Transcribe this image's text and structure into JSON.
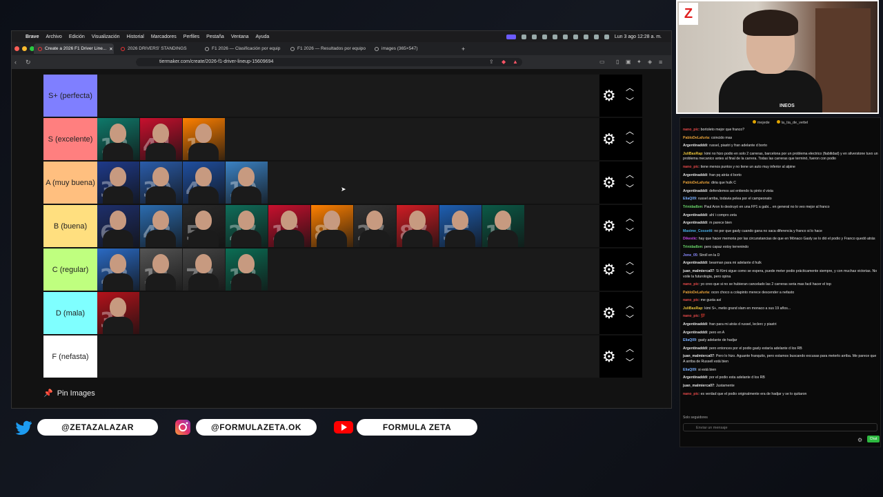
{
  "mac_menu": {
    "items": [
      "Brave",
      "Archivo",
      "Edición",
      "Visualización",
      "Historial",
      "Marcadores",
      "Perfiles",
      "Pestaña",
      "Ventana",
      "Ayuda"
    ],
    "clock": "Lun 3 ago 12:28 a. m."
  },
  "browser": {
    "tabs": [
      {
        "title": "Create a 2026 F1 Driver Line..."
      },
      {
        "title": "2026 DRIVERS' STANDINGS"
      },
      {
        "title": "F1 2026 — Clasificación por equip"
      },
      {
        "title": "F1 2026 — Resultados por equipo"
      },
      {
        "title": "images (365×547)"
      }
    ],
    "url": "tiermaker.com/create/2026-f1-driver-lineup-15609694"
  },
  "tiers": [
    {
      "label": "S+ (perfecta)",
      "color": "#7f7fff",
      "drivers": []
    },
    {
      "label": "S (excelente)",
      "color": "#ff7f7f",
      "drivers": [
        {
          "num": "12",
          "team": "#0f7a6b"
        },
        {
          "num": "44",
          "team": "#c8102e"
        },
        {
          "num": "1",
          "team": "#ff8000"
        }
      ]
    },
    {
      "label": "A (muy buena)",
      "color": "#ffbf7f",
      "drivers": [
        {
          "num": "3",
          "team": "#1e3a8a"
        },
        {
          "num": "30",
          "team": "#2a5caa"
        },
        {
          "num": "41",
          "team": "#1f4fa0"
        },
        {
          "num": "10",
          "team": "#3b82c4"
        }
      ]
    },
    {
      "label": "B (buena)",
      "color": "#ffdf7f",
      "drivers": [
        {
          "num": "6",
          "team": "#1e2f6b"
        },
        {
          "num": "43",
          "team": "#2b6cb0"
        },
        {
          "num": "5",
          "team": "#2a2a2a"
        },
        {
          "num": "27",
          "team": "#0f6e5a"
        },
        {
          "num": "16",
          "team": "#c8102e"
        },
        {
          "num": "81",
          "team": "#ff8000"
        },
        {
          "num": "27",
          "team": "#333333"
        },
        {
          "num": "87",
          "team": "#d01c24"
        },
        {
          "num": "55",
          "team": "#1e5fb3"
        },
        {
          "num": "14",
          "team": "#0b5a47"
        }
      ]
    },
    {
      "label": "C (regular)",
      "color": "#bfff7f",
      "drivers": [
        {
          "num": "23",
          "team": "#2a6ac4"
        },
        {
          "num": "11",
          "team": "#555555"
        },
        {
          "num": "77",
          "team": "#444444"
        },
        {
          "num": "18",
          "team": "#0b6e55"
        }
      ]
    },
    {
      "label": "D (mala)",
      "color": "#7fffff",
      "drivers": [
        {
          "num": "31",
          "team": "#b5121b"
        }
      ]
    },
    {
      "label": "F (nefasta)",
      "color": "#ffffff",
      "drivers": []
    }
  ],
  "pin_label": "Pin Images",
  "webcam": {
    "logo": "Z",
    "brand": "INEOS"
  },
  "chat": {
    "header": [
      {
        "name": "mejede"
      },
      {
        "name": "la_tia_de_vettel"
      }
    ],
    "messages": [
      {
        "user": "nano_pic",
        "color": "#e84a4a",
        "text": "bortoleto mejor que franco?"
      },
      {
        "user": "PabloDeLafuria",
        "color": "#e8a23a",
        "text": "coincido mas"
      },
      {
        "user": "Argentinadddi",
        "color": "#e4e4e4",
        "text": "russel, piastri y fran adelante d borto"
      },
      {
        "user": "JuliBasRap",
        "color": "#e8c23a",
        "text": "kimi no hizo podio en solo 2 carreras, barcelona por un problema electrico (fiabilidad) y en silverstone tuvo un problema mecanico antes al final de la carrera. Todas las carreras que terminó, fueron con podio"
      },
      {
        "user": "nano_pic",
        "color": "#e84a4a",
        "text": "tiene menos puntos y no tiene un auto muy inferior al alpine"
      },
      {
        "user": "Argentinadddi",
        "color": "#e4e4e4",
        "text": "fran pq atrás d borto"
      },
      {
        "user": "PabloDeLafuria",
        "color": "#e8a23a",
        "text": "diria que hulk C"
      },
      {
        "user": "Argentinadddi",
        "color": "#e4e4e4",
        "text": "defendemos asi entiendo tu pinto d vista"
      },
      {
        "user": "EliaQ09",
        "color": "#7ab0ff",
        "text": "russel arriba, todavia pelea por el campeonato"
      },
      {
        "user": "Trinidadbm",
        "color": "#6ad46a",
        "text": "Paul Aron lo destruyó en una FP1 a gabi... en general no lo veo mejor al franco"
      },
      {
        "user": "Argentinadddi",
        "color": "#e4e4e4",
        "text": "ahí i compro zeta"
      },
      {
        "user": "Argentinadddi",
        "color": "#e4e4e4",
        "text": "m parece bien"
      },
      {
        "user": "Maxime_Cossetti",
        "color": "#4ab0e8",
        "text": "no por que gasly cuando gana no saca diferencia y franco si lo hace"
      },
      {
        "user": "Dikestic",
        "color": "#c84ae8",
        "text": "hay que hacer memoria por las circunstancias de que en Mónaco Gasly se lo dió el podio y Franco quedó atrás"
      },
      {
        "user": "Trinidadbm",
        "color": "#6ad46a",
        "text": "pero capaz estoy terrenindo"
      },
      {
        "user": "Jone_05",
        "color": "#8a8aff",
        "text": "Stroll en la D"
      },
      {
        "user": "Argentinadddi",
        "color": "#e4e4e4",
        "text": "bearman para mi adelante d hulk"
      },
      {
        "user": "juan_malmierca07",
        "color": "#e4e4e4",
        "text": "Si Kimi sigue como se espera, puede meter podio prácticamente siempre, y con muchas victorias. No voile la futurologia, pero opina"
      },
      {
        "user": "nano_pic",
        "color": "#e84a4a",
        "text": "yo creo que si no se hubieran cancelado las 2 carreras seria mas facil hacer el top"
      },
      {
        "user": "PabloDeLafuria",
        "color": "#e8a23a",
        "text": "ocon choco a colapinto merece descender a nefasto"
      },
      {
        "user": "nano_pic",
        "color": "#e84a4a",
        "text": "me gusta así"
      },
      {
        "user": "JuliBasRap",
        "color": "#e8c23a",
        "text": "kimi S+, metio grand slam en monaco a sus 19 años..."
      },
      {
        "user": "nano_pic",
        "color": "#e84a4a",
        "text": "💯"
      },
      {
        "user": "Argentinadddi",
        "color": "#e4e4e4",
        "text": "fran para mi atrás d russel, leclerc y piastri"
      },
      {
        "user": "Argentinadddi",
        "color": "#e4e4e4",
        "text": "pero en A"
      },
      {
        "user": "EliaQ09",
        "color": "#7ab0ff",
        "text": "gasly adelante de hadjar"
      },
      {
        "user": "Argentinadddi",
        "color": "#e4e4e4",
        "text": "pero entonces por el podio gasly estaría adelante d los RB"
      },
      {
        "user": "juan_malmierca07",
        "color": "#e4e4e4",
        "text": "Pero lo hizo. Aguante franquito, pero estamos buscando excusas para meterlo arriba. Me parece que A arriba de Russell está bien"
      },
      {
        "user": "EliaQ09",
        "color": "#7ab0ff",
        "text": "si está bien"
      },
      {
        "user": "Argentinadddi",
        "color": "#e4e4e4",
        "text": "por el podio esta adelante d los RB"
      },
      {
        "user": "juan_malmierca07",
        "color": "#e4e4e4",
        "text": "Justamente"
      },
      {
        "user": "nano_pic",
        "color": "#e84a4a",
        "text": "es verdad que el podio originalmente era de hadjar y se lo quitaron"
      }
    ],
    "follow_note": "Solo seguidores",
    "input_placeholder": "Enviar un mensaje",
    "send_label": "Chat"
  },
  "socials": {
    "twitter": "@ZETAZALAZAR",
    "instagram": "@FORMULAZETA.OK",
    "youtube": "FORMULA ZETA"
  }
}
